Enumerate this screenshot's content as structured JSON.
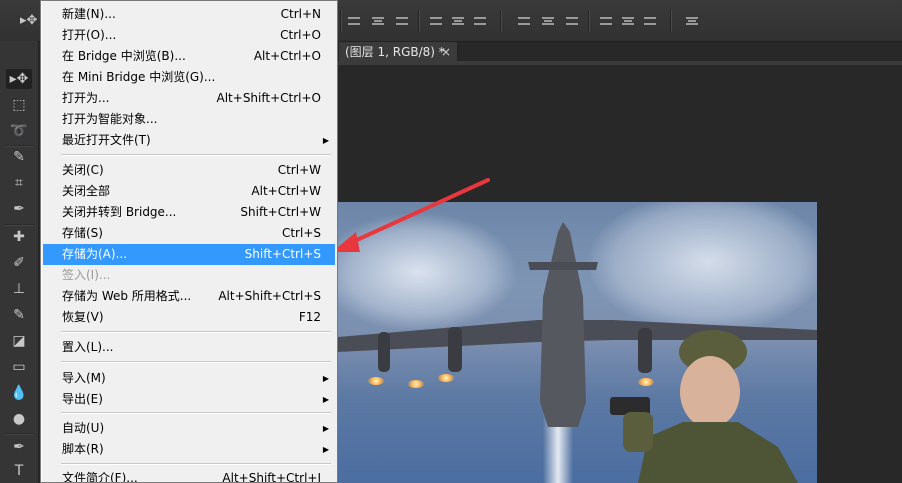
{
  "document_tab": {
    "title": "(图层 1, RGB/8) *",
    "close": "×"
  },
  "file_menu": {
    "items": [
      {
        "label": "新建(N)...",
        "shortcut": "Ctrl+N"
      },
      {
        "label": "打开(O)...",
        "shortcut": "Ctrl+O"
      },
      {
        "label": "在 Bridge 中浏览(B)...",
        "shortcut": "Alt+Ctrl+O"
      },
      {
        "label": "在 Mini Bridge 中浏览(G)...",
        "shortcut": ""
      },
      {
        "label": "打开为...",
        "shortcut": "Alt+Shift+Ctrl+O"
      },
      {
        "label": "打开为智能对象...",
        "shortcut": ""
      },
      {
        "label": "最近打开文件(T)",
        "shortcut": ""
      },
      {
        "label": "关闭(C)",
        "shortcut": "Ctrl+W"
      },
      {
        "label": "关闭全部",
        "shortcut": "Alt+Ctrl+W"
      },
      {
        "label": "关闭并转到 Bridge...",
        "shortcut": "Shift+Ctrl+W"
      },
      {
        "label": "存储(S)",
        "shortcut": "Ctrl+S"
      },
      {
        "label": "存储为(A)...",
        "shortcut": "Shift+Ctrl+S"
      },
      {
        "label": "签入(I)...",
        "shortcut": ""
      },
      {
        "label": "存储为 Web 所用格式...",
        "shortcut": "Alt+Shift+Ctrl+S"
      },
      {
        "label": "恢复(V)",
        "shortcut": "F12"
      },
      {
        "label": "置入(L)...",
        "shortcut": ""
      },
      {
        "label": "导入(M)",
        "shortcut": ""
      },
      {
        "label": "导出(E)",
        "shortcut": ""
      },
      {
        "label": "自动(U)",
        "shortcut": ""
      },
      {
        "label": "脚本(R)",
        "shortcut": ""
      },
      {
        "label": "文件简介(F)...",
        "shortcut": "Alt+Shift+Ctrl+I"
      }
    ],
    "submenu_arrow": "▶"
  },
  "colors": {
    "menu_highlight": "#3399ff",
    "annotation_arrow": "#e8383d",
    "workspace": "#282828"
  },
  "tools": [
    "move-tool-icon",
    "marquee-tool-icon",
    "lasso-tool-icon",
    "quick-select-tool-icon",
    "crop-tool-icon",
    "eyedropper-tool-icon",
    "healing-brush-tool-icon",
    "brush-tool-icon",
    "clone-stamp-tool-icon",
    "history-brush-tool-icon",
    "eraser-tool-icon",
    "gradient-tool-icon",
    "blur-tool-icon",
    "dodge-tool-icon",
    "pen-tool-icon",
    "type-tool-icon"
  ]
}
